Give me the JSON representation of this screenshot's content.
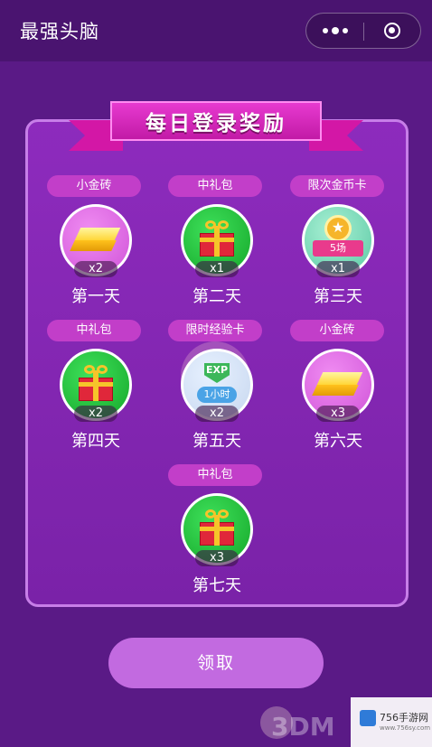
{
  "app": {
    "title": "最强头脑"
  },
  "panel": {
    "title": "每日登录奖励"
  },
  "rewards": [
    {
      "label": "小金砖",
      "qty": "x2",
      "day": "第一天",
      "icon": "gold-bar-icon"
    },
    {
      "label": "中礼包",
      "qty": "x1",
      "day": "第二天",
      "icon": "gift-box-icon"
    },
    {
      "label": "限次金币卡",
      "qty": "x1",
      "day": "第三天",
      "icon": "star-medal-icon",
      "badge": "5场"
    },
    {
      "label": "中礼包",
      "qty": "x2",
      "day": "第四天",
      "icon": "gift-box-icon"
    },
    {
      "label": "限时经验卡",
      "qty": "x2",
      "day": "第五天",
      "icon": "exp-card-icon",
      "badge_top": "EXP",
      "badge": "1小时"
    },
    {
      "label": "小金砖",
      "qty": "x3",
      "day": "第六天",
      "icon": "gold-bar-icon"
    },
    {
      "label": "中礼包",
      "qty": "x3",
      "day": "第七天",
      "icon": "gift-box-icon"
    }
  ],
  "actions": {
    "claim_label": "领取"
  },
  "watermark": {
    "site": "756手游网",
    "url": "www.756sy.com",
    "brand": "3DM"
  }
}
